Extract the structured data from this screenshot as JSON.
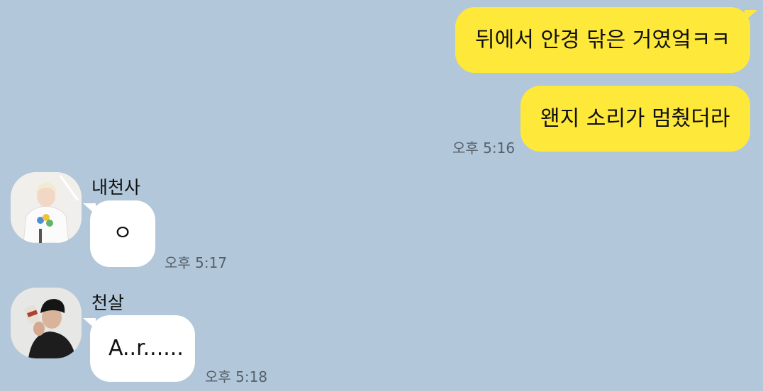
{
  "chat": {
    "outgoing": [
      {
        "text": "뒤에서 안경 닦은 거였엌ㅋㅋ"
      },
      {
        "text": "왠지 소리가 멈췄더라",
        "time": "오후 5:16"
      }
    ],
    "incoming": [
      {
        "sender": "내천사",
        "text": "ㅇ",
        "time": "오후 5:17",
        "avatar_icon": "profile-photo-light"
      },
      {
        "sender": "천살",
        "text": "A..r......",
        "time": "오후 5:18",
        "avatar_icon": "profile-photo-dark"
      }
    ]
  },
  "colors": {
    "background": "#b2c7da",
    "outgoing_bubble": "#fee93a",
    "incoming_bubble": "#ffffff",
    "timestamp": "#56606b"
  }
}
